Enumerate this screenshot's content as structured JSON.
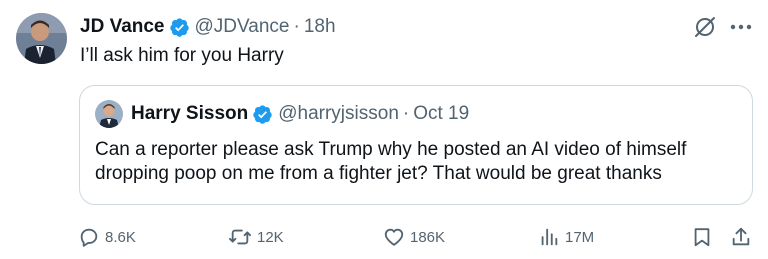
{
  "tweet": {
    "author": {
      "name": "JD Vance",
      "handle": "@JDVance",
      "time": "18h",
      "verified": true
    },
    "separator": "·",
    "text": "I’ll ask him for you Harry"
  },
  "quoted": {
    "author": {
      "name": "Harry Sisson",
      "handle": "@harryjsisson",
      "time": "Oct 19",
      "verified": true
    },
    "separator": "·",
    "text": "Can a reporter please ask Trump why he posted an AI video of himself dropping poop on me from a fighter jet? That would be great thanks"
  },
  "actions": {
    "replies": "8.6K",
    "reposts": "12K",
    "likes": "186K",
    "views": "17M"
  },
  "icons": {
    "verified": "verified-badge-icon",
    "grok": "grok-icon",
    "more": "more-options-icon",
    "reply": "reply-icon",
    "repost": "repost-icon",
    "like": "heart-icon",
    "views": "analytics-icon",
    "bookmark": "bookmark-icon",
    "share": "share-icon"
  },
  "colors": {
    "text": "#0f1419",
    "secondary": "#536471",
    "verified": "#1d9bf0",
    "border": "#cfd9de"
  }
}
